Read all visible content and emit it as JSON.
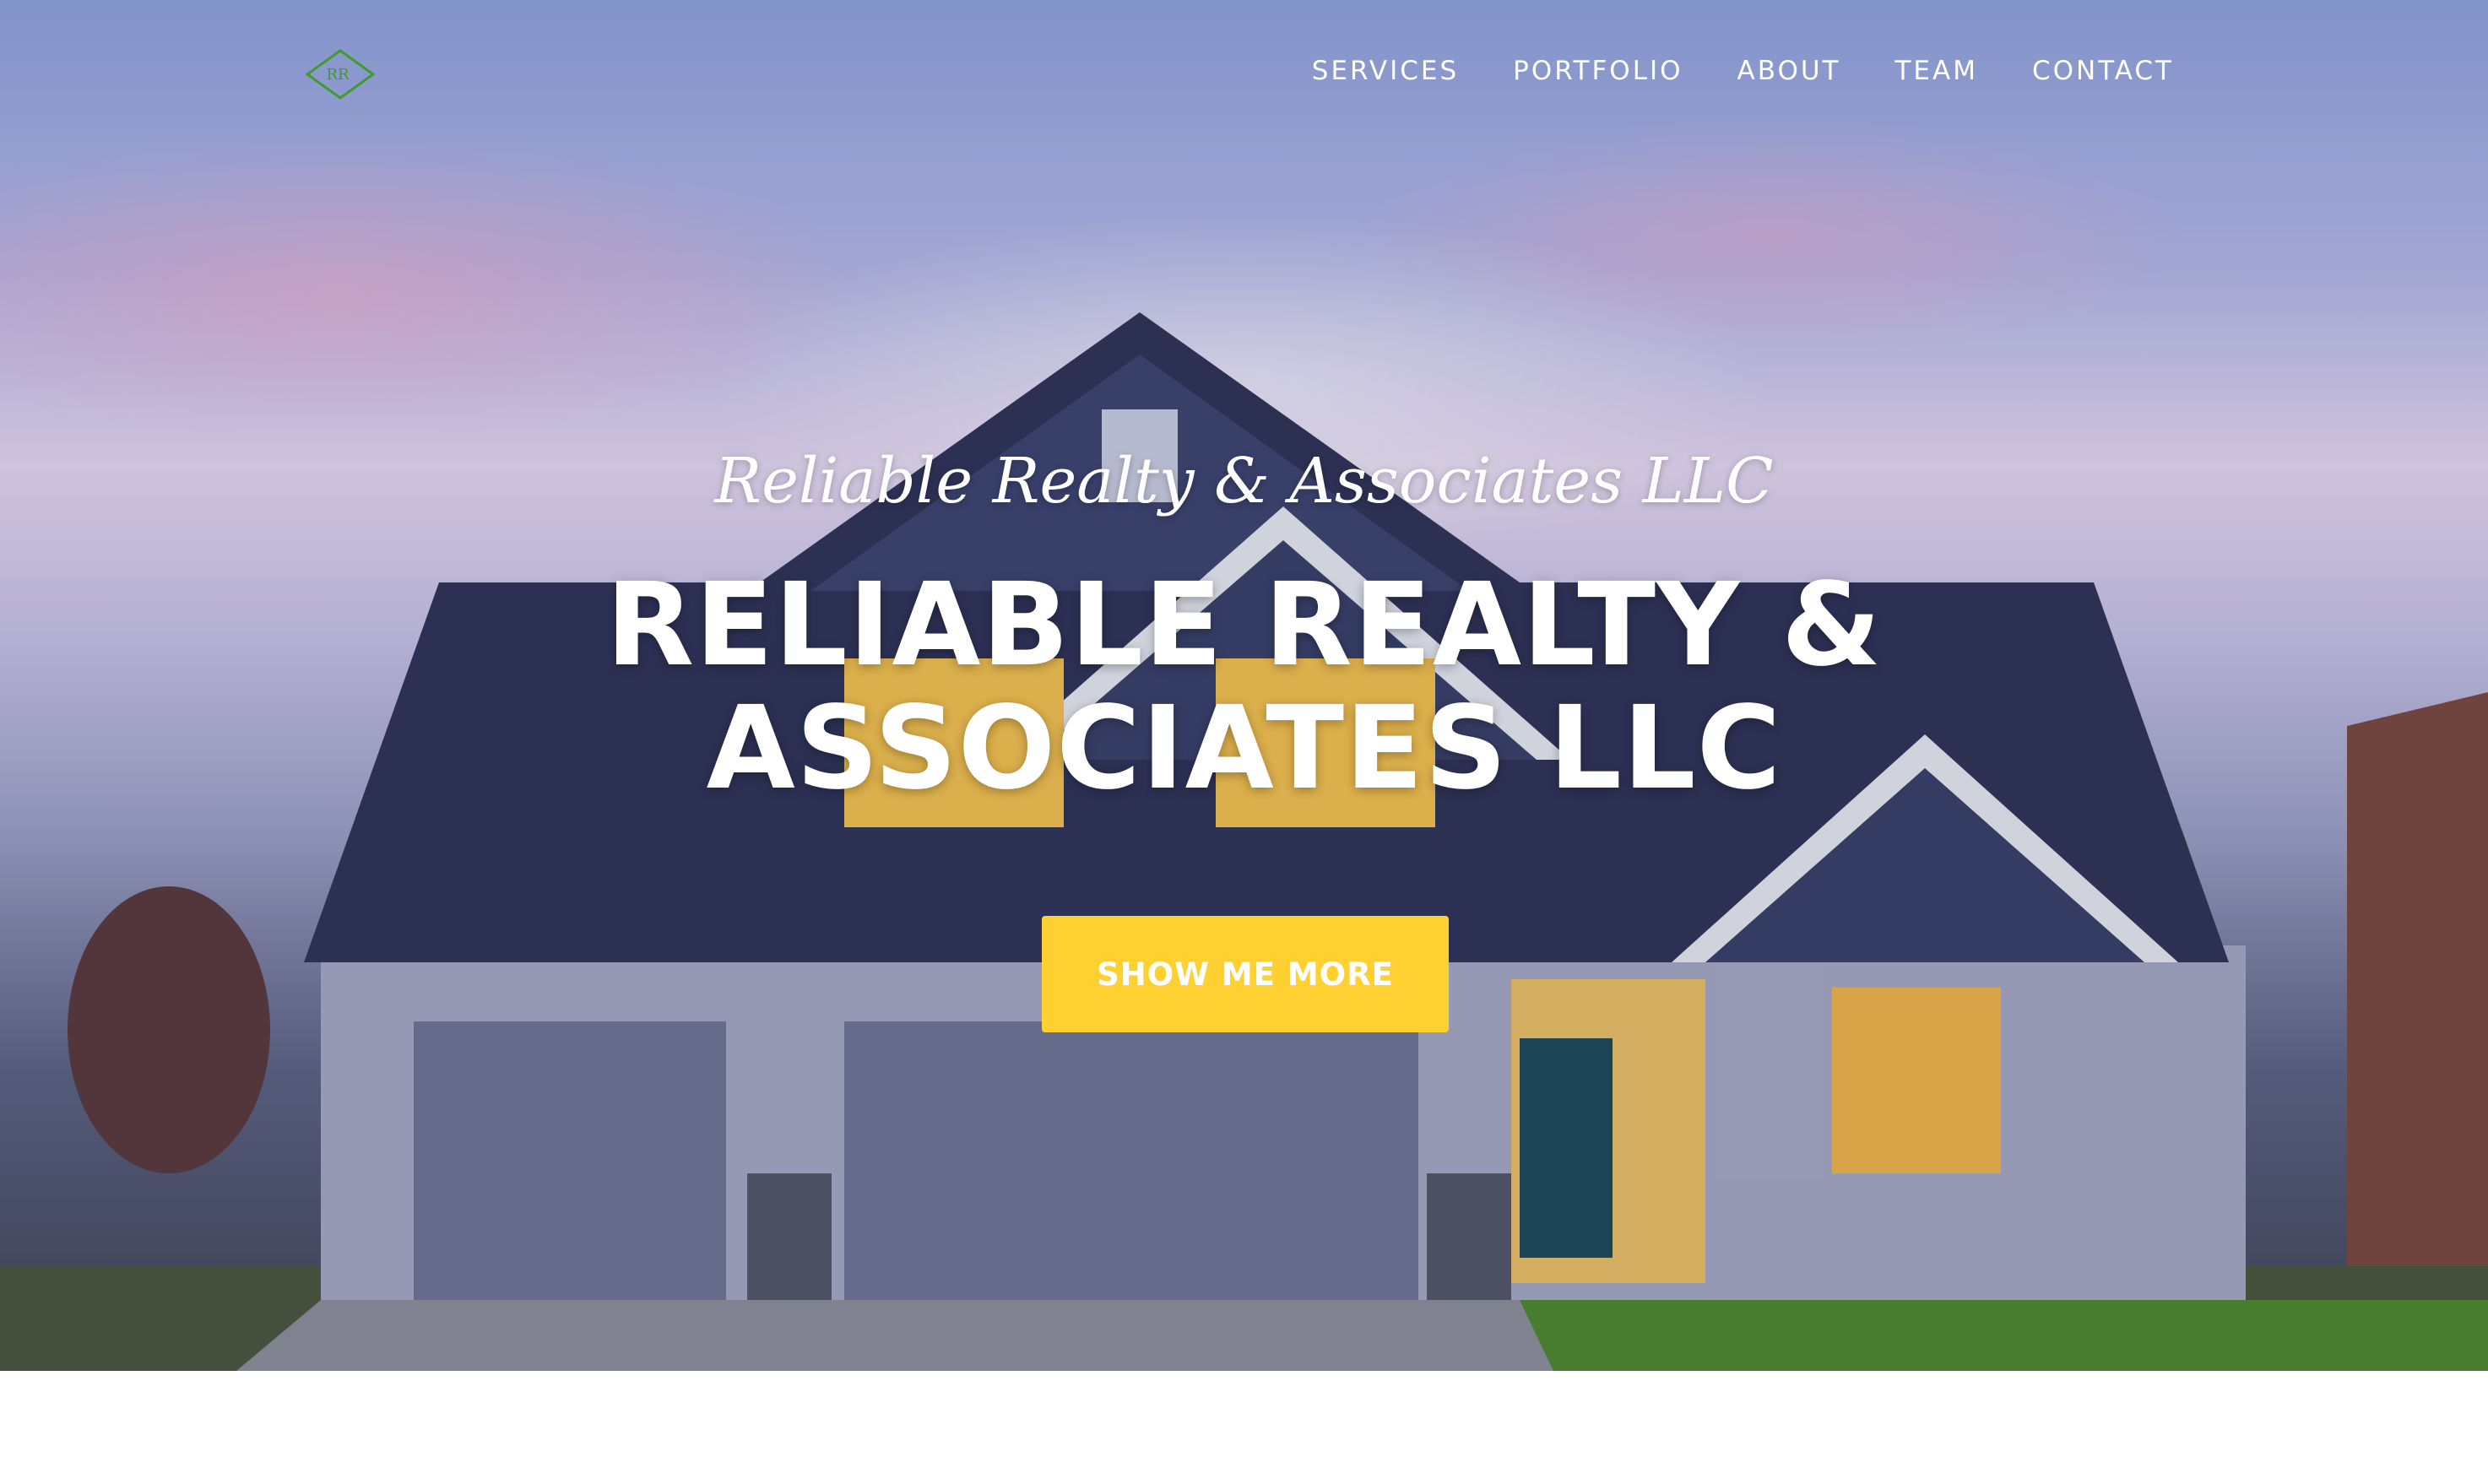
{
  "nav": {
    "items": [
      {
        "label": "SERVICES"
      },
      {
        "label": "PORTFOLIO"
      },
      {
        "label": "ABOUT"
      },
      {
        "label": "TEAM"
      },
      {
        "label": "CONTACT"
      }
    ]
  },
  "logo": {
    "icon": "diamond-rr-logo",
    "text": "RR",
    "color": "#3f9b2e"
  },
  "hero": {
    "subtitle": "Reliable Realty & Associates LLC",
    "headline_line1": "RELIABLE REALTY &",
    "headline_line2": "ASSOCIATES LLC",
    "cta_label": "SHOW ME MORE",
    "cta_color": "#ffd032"
  }
}
